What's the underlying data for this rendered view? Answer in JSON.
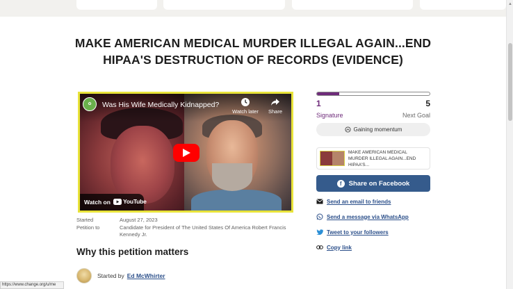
{
  "page": {
    "title": "MAKE AMERICAN MEDICAL MURDER ILLEGAL AGAIN...END HIPAA'S DESTRUCTION OF RECORDS (EVIDENCE)"
  },
  "video": {
    "title": "Was His Wife Medically Kidnapped?",
    "watch_later_label": "Watch later",
    "share_label": "Share",
    "watch_on_label": "Watch on",
    "youtube_label": "YouTube"
  },
  "meta": {
    "started_label": "Started",
    "started_value": "August 27, 2023",
    "petition_to_label": "Petition to",
    "petition_to_value": "Candidate for President of The United States Of America Robert Francis Kennedy Jr."
  },
  "why_heading": "Why this petition matters",
  "starter": {
    "prefix": "Started by",
    "name": "Ed McWhirter"
  },
  "status_bar": {
    "url": "https://www.change.org/u/me"
  },
  "signatures": {
    "current": "1",
    "goal": "5",
    "progress_fraction": 0.2,
    "current_label": "Signature",
    "goal_label": "Next Goal"
  },
  "momentum_label": "Gaining momentum",
  "petition_card": {
    "title": "MAKE AMERICAN MEDICAL MURDER ILLEGAL AGAIN...END HIPAA'S..."
  },
  "share": {
    "facebook_label": "Share on Facebook",
    "email_label": "Send an email to friends",
    "whatsapp_label": "Send a message via WhatsApp",
    "twitter_label": "Tweet to your followers",
    "copy_label": "Copy link"
  },
  "colors": {
    "brand_purple": "#6e2b7a",
    "facebook_blue": "#355b8c",
    "link_blue": "#2b4f8a",
    "video_border": "#e8e33a"
  }
}
